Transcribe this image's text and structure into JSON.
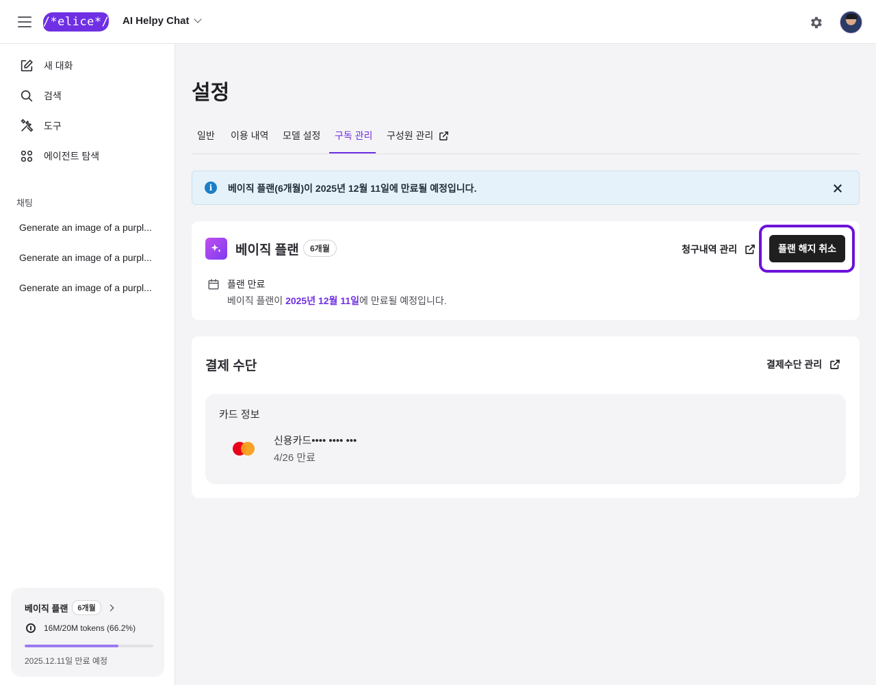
{
  "header": {
    "logo_text": "/*elice*/",
    "app_title": "AI Helpy Chat"
  },
  "sidebar": {
    "nav": [
      {
        "label": "새 대화",
        "icon": "edit-icon"
      },
      {
        "label": "검색",
        "icon": "search-icon"
      },
      {
        "label": "도구",
        "icon": "tools-icon"
      },
      {
        "label": "에이전트 탐색",
        "icon": "grid-icon"
      }
    ],
    "section_label": "채팅",
    "chats": [
      "Generate an image of a purpl...",
      "Generate an image of a purpl...",
      "Generate an image of a purpl..."
    ],
    "plan_card": {
      "title": "베이직 플랜",
      "badge": "6개월",
      "usage": "16M/20M tokens (66.2%)",
      "usage_fraction": 0.73,
      "expire": "2025.12.11일 만료 예정"
    }
  },
  "main": {
    "title": "설정",
    "tabs": [
      {
        "label": "일반"
      },
      {
        "label": "이용 내역"
      },
      {
        "label": "모델 설정"
      },
      {
        "label": "구독 관리"
      },
      {
        "label": "구성원 관리"
      }
    ],
    "active_tab": "구독 관리",
    "banner": "베이직 플랜(6개월)이 2025년 12월 11일에 만료될 예정입니다.",
    "plan": {
      "name": "베이직 플랜",
      "term": "6개월",
      "billing_link": "청구내역 관리",
      "cancel_button": "플랜 해지 취소",
      "expire_label": "플랜 만료",
      "expire_prefix": "베이직 플랜이 ",
      "expire_date": "2025년 12월 11일",
      "expire_suffix": "에 만료될 예정입니다."
    },
    "payment": {
      "title": "결제 수단",
      "manage_link": "결제수단 관리",
      "card_section_title": "카드 정보",
      "card_number": "신용카드•••• •••• •••",
      "card_expiry": "4/26 만료"
    }
  },
  "colors": {
    "accent": "#6f2fe3",
    "highlight_ring": "#6d12d9",
    "info": "#1c7fc6"
  }
}
